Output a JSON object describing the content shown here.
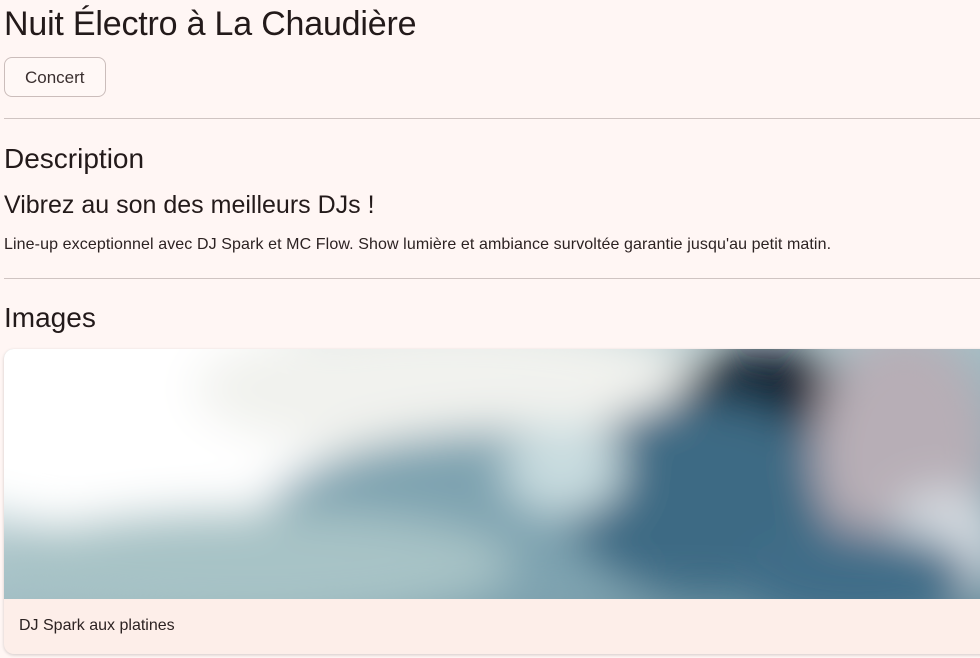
{
  "event": {
    "title": "Nuit Électro à La Chaudière",
    "category_chip": "Concert"
  },
  "description": {
    "heading": "Description",
    "subtitle": "Vibrez au son des meilleurs DJs !",
    "body": "Line-up exceptionnel avec DJ Spark et MC Flow. Show lumière et ambiance survoltée garantie jusqu'au petit matin."
  },
  "images": {
    "heading": "Images",
    "items": [
      {
        "caption": "DJ Spark aux platines"
      }
    ]
  }
}
